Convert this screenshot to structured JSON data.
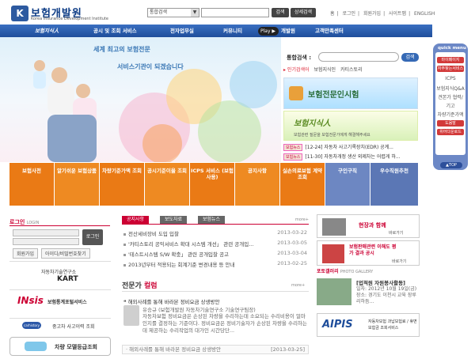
{
  "header": {
    "logo_mark": "K",
    "logo_text": "보험개발원",
    "logo_sub": "Korea Insurance Development Institute",
    "search_select": "통합검색",
    "search_button": "검색",
    "adv_button": "상세검색",
    "toplinks": [
      "홈",
      "로그인",
      "회원가입",
      "사이트맵",
      "ENGLISH"
    ]
  },
  "nav": {
    "items": [
      "보험지식人",
      "공시 및 조회 서비스",
      "전자업무실",
      "커뮤니티",
      "개발원",
      "고객만족센터"
    ],
    "play_label": "Play ▶"
  },
  "hero": {
    "line1": "세계 최고의 보험전문",
    "line2": "서비스기관이 되겠습니다"
  },
  "right": {
    "integ_label": "통합검색 :",
    "integ_button": "검색",
    "popular_label": "▸ 인기검색어",
    "popular_terms": [
      "보험지식인",
      "카티스토리"
    ],
    "banner1": "보험전문인시험",
    "banner2": "보험지식人",
    "banner2_sub": "보험관련 질문을 보험전문가에게 해결해주세요",
    "news": [
      {
        "tag": "보험뉴스",
        "text": "[12-24] 자동차 사고기록장치(EDR) 공계..."
      },
      {
        "tag": "보험뉴스",
        "text": "[11-30] 자동차개정 생산 외제차는 어렵게 하..."
      }
    ]
  },
  "quick": {
    "title": "quick menu",
    "items": [
      {
        "label": "마이페이지",
        "type": "red"
      },
      {
        "label": "자주찾는서비스",
        "type": "red"
      },
      {
        "label": "ICPS",
        "type": "text"
      },
      {
        "label": "보험지식Q&A",
        "type": "text"
      },
      {
        "label": "견본가 협력/",
        "type": "text"
      },
      {
        "label": "기고",
        "type": "text"
      },
      {
        "label": "차량기준가액",
        "type": "text"
      },
      {
        "label": "도움말",
        "type": "red"
      },
      {
        "label": "위어다운로드",
        "type": "red"
      }
    ],
    "top": "▲TOP"
  },
  "tiles": [
    {
      "label": "보험사전",
      "color": "#e8730f"
    },
    {
      "label": "알기쉬운 보험상품",
      "color": "#e8730f"
    },
    {
      "label": "차량기준가액 조회",
      "color": "#e8730f"
    },
    {
      "label": "공시기준이율 조회",
      "color": "#e8730f"
    },
    {
      "label": "ICPS 서비스 (보험사용)",
      "color": "#e8730f"
    },
    {
      "label": "공지사항",
      "color": "#e8730f"
    },
    {
      "label": "실손의료보험 계약조회",
      "color": "#e8730f"
    },
    {
      "label": "구인구직",
      "color": "#6d87c2"
    },
    {
      "label": "우수직원추천",
      "color": "#6d87c2"
    }
  ],
  "login": {
    "title": "로그인",
    "title_en": "LOGIN",
    "button": "로그인",
    "links": [
      "회원가입",
      "아이디/비밀번호찾기"
    ]
  },
  "side_banners": [
    {
      "title": "자동차기술연구소",
      "sub": "KART"
    },
    {
      "title": "INsis",
      "sub": "보험통계포털서비스"
    },
    {
      "title": "중고차 사고이력 조회",
      "sub": "carhistory"
    },
    {
      "title": "차량 모델등급조회",
      "sub": ""
    }
  ],
  "notices": {
    "tabs": [
      "공지사항",
      "보도자료",
      "보험뉴스"
    ],
    "more": "more+",
    "items": [
      {
        "text": "전산세비장비 도입 입찰",
        "date": "2013-03-22"
      },
      {
        "text": "'카티스토리 공익서비스 확대 시스템 개선」 관련 공개입...",
        "date": "2013-03-05"
      },
      {
        "text": "'테스트시스템 S/W 확충」 관련 공개입찰 공고",
        "date": "2013-03-04"
      },
      {
        "text": "2013년부터 적용되는 회계기준 변경내용 등 안내",
        "date": "2013-02-25"
      }
    ]
  },
  "expert": {
    "title_a": "전문가",
    "title_b": "컬럼",
    "more": "more+",
    "question": "해외사례를 통해 바라본 정비요금 상생방안",
    "author": "유승규 (보험개발원 자동차기술연구소 기술연구팀장)",
    "body": "자동차보험 정비요금은 손상된 차량을 수리하는데 소요되는 수리비용이 얼마인지를 결정하는 기준이다. 정비요금은 정비기술자가 손상된 차량을 수리하는데 제공하는 수리작업의 대가인 시간당단...",
    "footer_text": "· 해외사례를 통해 바라본 정비요금 상생방안",
    "footer_date": "[2013-03-25]"
  },
  "right_lower": {
    "banner_a": "현장과 함께",
    "banner_a_sub": "바로가기",
    "banner_b": "보험판매관련 이해도 평가 결과 공시",
    "banner_b_sub": "바로가기",
    "photo_title": "포토갤러리",
    "photo_sub": "PHOTO GALLERY",
    "photo_caption_title": "[업적원 자원봉사활동]",
    "photo_caption": "일자: 2012년 10월 19일(금) 장소: 경기도 이천시 교육 장루리하듬...",
    "aipis": "AIPIS",
    "aipis_sub": "자동차보험 과납보험료 / 휴면보험금 조회서비스"
  }
}
